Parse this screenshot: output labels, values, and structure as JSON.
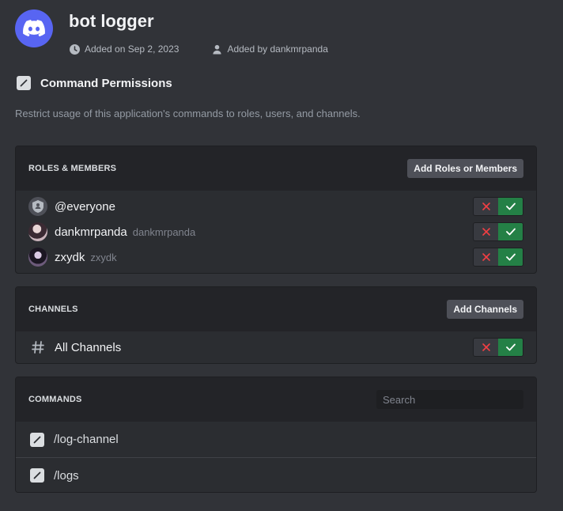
{
  "app": {
    "name": "bot logger",
    "added_on": "Added on Sep 2, 2023",
    "added_by": "Added by dankmrpanda",
    "brand_color": "#5865f2"
  },
  "section": {
    "title": "Command Permissions",
    "description": "Restrict usage of this application's commands to roles, users, and channels."
  },
  "roles_members": {
    "title": "ROLES & MEMBERS",
    "button": "Add Roles or Members",
    "rows": [
      {
        "label": "@everyone",
        "sub": "",
        "icon": "shield-icon",
        "state": "allow"
      },
      {
        "label": "dankmrpanda",
        "sub": "dankmrpanda",
        "icon": "avatar",
        "state": "allow"
      },
      {
        "label": "zxydk",
        "sub": "zxydk",
        "icon": "avatar",
        "state": "allow"
      }
    ]
  },
  "channels": {
    "title": "CHANNELS",
    "button": "Add Channels",
    "rows": [
      {
        "label": "All Channels",
        "icon": "hash-icon",
        "state": "allow"
      }
    ]
  },
  "commands": {
    "title": "COMMANDS",
    "search_placeholder": "Search",
    "items": [
      {
        "label": "/log-channel",
        "icon": "slash-command-icon"
      },
      {
        "label": "/logs",
        "icon": "slash-command-icon"
      }
    ]
  },
  "colors": {
    "allow": "#248046",
    "deny_icon": "#f23f43",
    "background": "#313338"
  }
}
